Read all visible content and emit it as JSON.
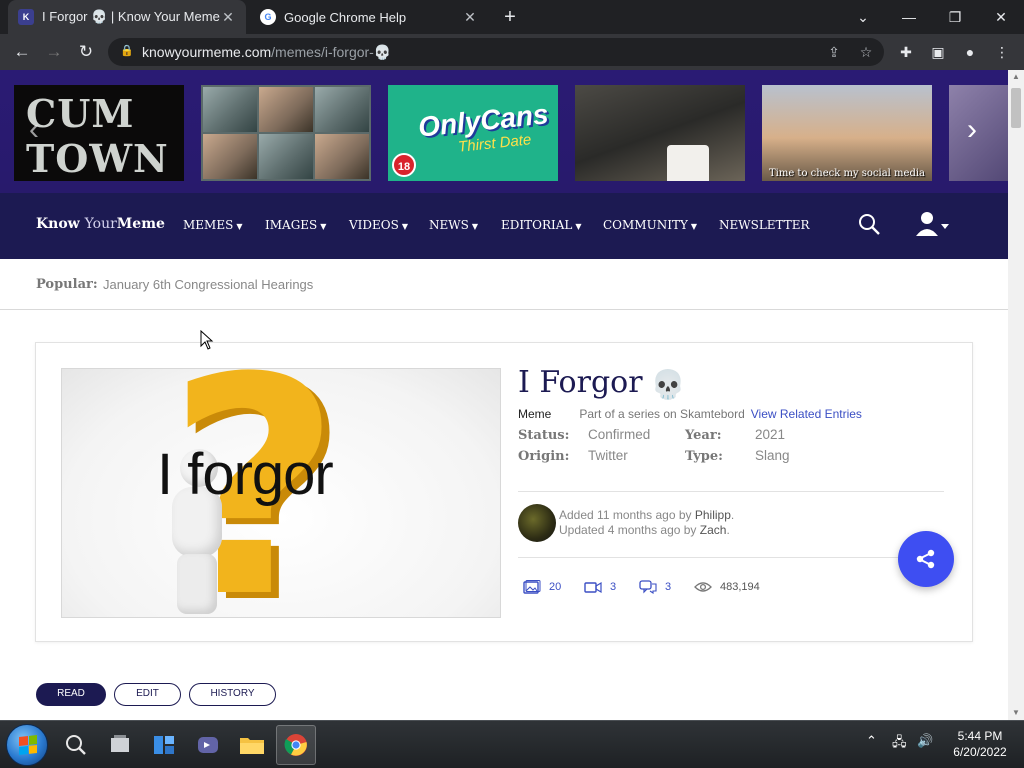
{
  "browser": {
    "tabs": [
      {
        "title": "I Forgor 💀 | Know Your Meme",
        "favicon": "kym-favicon-icon",
        "active": true
      },
      {
        "title": "Google Chrome Help",
        "favicon": "google-favicon-icon",
        "active": false
      }
    ],
    "url_host": "knowyourmeme.com",
    "url_path": "/memes/i-forgor-💀"
  },
  "carousel": {
    "items": [
      {
        "text": "CUM TOWN"
      },
      {
        "text": ""
      },
      {
        "brand": "OnlyCans",
        "sub": "Thirst Date",
        "badge": "18"
      },
      {
        "text": ""
      },
      {
        "text": "Time to check my social media"
      },
      {
        "text": ""
      }
    ]
  },
  "nav": {
    "logo_bold": "Know",
    "logo_light": "Your",
    "logo_bold2": "Meme",
    "items": [
      "MEMES",
      "IMAGES",
      "VIDEOS",
      "NEWS",
      "EDITORIAL",
      "COMMUNITY",
      "NEWSLETTER"
    ]
  },
  "popular": {
    "label": "Popular:",
    "link": "January 6th Congressional Hearings"
  },
  "entry": {
    "image_caption": "I forgor",
    "title": "I Forgor",
    "title_emoji": "💀",
    "type": "Meme",
    "series_text": "Part of a series on Skamtebord",
    "related_link": "View Related Entries",
    "facts": {
      "status_label": "Status:",
      "status_value": "Confirmed",
      "origin_label": "Origin:",
      "origin_value": "Twitter",
      "year_label": "Year:",
      "year_value": "2021",
      "type_label": "Type:",
      "type_value": "Slang"
    },
    "added_prefix": "Added 11 months ago by ",
    "added_by": "Philipp",
    "updated_prefix": "Updated 4 months ago by ",
    "updated_by": "Zach",
    "stats": {
      "images": "20",
      "videos": "3",
      "comments": "3",
      "views": "483,194"
    }
  },
  "tabs_row": [
    "READ",
    "EDIT",
    "HISTORY"
  ],
  "taskbar": {
    "time": "5:44 PM",
    "date": "6/20/2022"
  },
  "colors": {
    "brand_navy": "#1c1a52",
    "carousel_purple": "#2a1b74",
    "share_blue": "#3e4ef2",
    "link_blue": "#3b4fc4"
  }
}
